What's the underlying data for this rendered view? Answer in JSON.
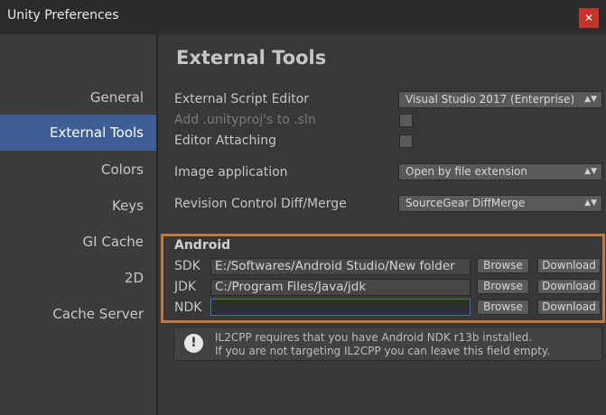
{
  "window": {
    "title": "Unity Preferences",
    "close_glyph": "✕"
  },
  "sidebar": {
    "items": [
      {
        "label": "General"
      },
      {
        "label": "External Tools"
      },
      {
        "label": "Colors"
      },
      {
        "label": "Keys"
      },
      {
        "label": "GI Cache"
      },
      {
        "label": "2D"
      },
      {
        "label": "Cache Server"
      }
    ],
    "active_item": "External Tools"
  },
  "main": {
    "title": "External Tools",
    "external_script_editor": {
      "label": "External Script Editor",
      "value": "Visual Studio 2017 (Enterprise)"
    },
    "add_unityproj": {
      "label": "Add .unityproj's to .sln",
      "checked": false,
      "disabled": true
    },
    "editor_attaching": {
      "label": "Editor Attaching",
      "checked": false
    },
    "image_application": {
      "label": "Image application",
      "value": "Open by file extension"
    },
    "revision_control": {
      "label": "Revision Control Diff/Merge",
      "value": "SourceGear DiffMerge"
    },
    "dropdown_arrows": "▲▼"
  },
  "android": {
    "header": "Android",
    "browse_label": "Browse",
    "download_label": "Download",
    "sdk": {
      "label": "SDK",
      "value": "E:/Softwares/Android Studio/New folder"
    },
    "jdk": {
      "label": "JDK",
      "value": "C:/Program Files/Java/jdk"
    },
    "ndk": {
      "label": "NDK",
      "value": ""
    }
  },
  "info": {
    "icon_glyph": "!",
    "line1": "IL2CPP requires that you have Android NDK r13b installed.",
    "line2": "If you are not targeting IL2CPP you can leave this field empty."
  },
  "colors": {
    "accent_selection": "#3e5f96",
    "highlight_box": "#c07a3f",
    "close_button": "#c4342b"
  }
}
